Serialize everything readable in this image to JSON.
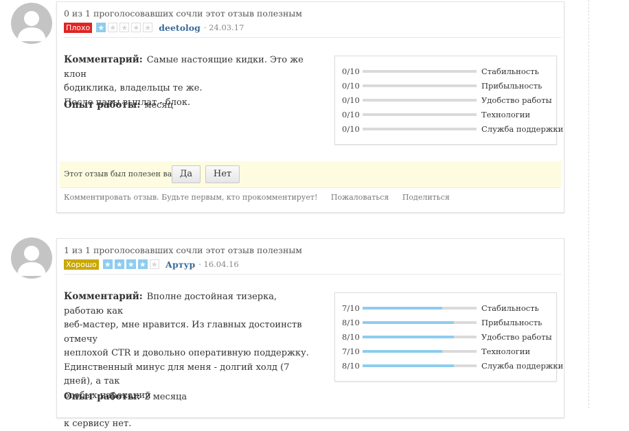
{
  "reviews": [
    {
      "votes_text": "0 из 1 проголосовавших сочли этот отзыв полезным",
      "badge_label": "Плохо",
      "badge_color": "#e02424",
      "stars_filled": 1,
      "stars_total": 5,
      "author": "deetolog",
      "date": "· 24.03.17",
      "comment_label": "Комментарий:",
      "comment_lines": [
        "Самые настоящие кидки. Это же клон",
        "бодиклика, владельцы те же.",
        "После пары выплат - блок."
      ],
      "experience_label": "Опыт работы:",
      "experience_value": "месяц",
      "ratings": [
        {
          "value": 0,
          "max": 10,
          "text": "0/10",
          "name": "Стабильность"
        },
        {
          "value": 0,
          "max": 10,
          "text": "0/10",
          "name": "Прибыльность"
        },
        {
          "value": 0,
          "max": 10,
          "text": "0/10",
          "name": "Удобство работы"
        },
        {
          "value": 0,
          "max": 10,
          "text": "0/10",
          "name": "Технологии"
        },
        {
          "value": 0,
          "max": 10,
          "text": "0/10",
          "name": "Служба поддержки"
        }
      ],
      "helpful_question": "Этот отзыв был полезен вам?",
      "yes_label": "Да",
      "no_label": "Нет",
      "footer_comment": "Комментировать отзыв. Будьте первым, кто прокомментирует!",
      "footer_report": "Пожаловаться",
      "footer_share": "Поделиться"
    },
    {
      "votes_text": "1 из 1 проголосовавших сочли этот отзыв полезным",
      "badge_label": "Хорошо",
      "badge_color": "#c9a800",
      "stars_filled": 4,
      "stars_total": 5,
      "author": "Артур",
      "date": "· 16.04.16",
      "comment_label": "Комментарий:",
      "comment_lines": [
        "Вполне достойная тизерка, работаю как",
        "веб-мастер, мне нравится. Из главных достоинств отмечу",
        "неплохой CTR и довольно оперативную поддержку.",
        "Единственный минус для меня - долгий холд (7 дней), а так",
        "особых нареканий",
        "",
        "к сервису нет."
      ],
      "experience_label": "Опыт работы:",
      "experience_value": "2 месяца",
      "ratings": [
        {
          "value": 7,
          "max": 10,
          "text": "7/10",
          "name": "Стабильность"
        },
        {
          "value": 8,
          "max": 10,
          "text": "8/10",
          "name": "Прибыльность"
        },
        {
          "value": 8,
          "max": 10,
          "text": "8/10",
          "name": "Удобство работы"
        },
        {
          "value": 7,
          "max": 10,
          "text": "7/10",
          "name": "Технологии"
        },
        {
          "value": 8,
          "max": 10,
          "text": "8/10",
          "name": "Служба поддержки"
        }
      ]
    }
  ],
  "colors": {
    "star_on": "#8dccf0",
    "bar_fill": "#8dccf0",
    "author": "#3a6b9a",
    "helpful_bg": "#fdfce0"
  }
}
